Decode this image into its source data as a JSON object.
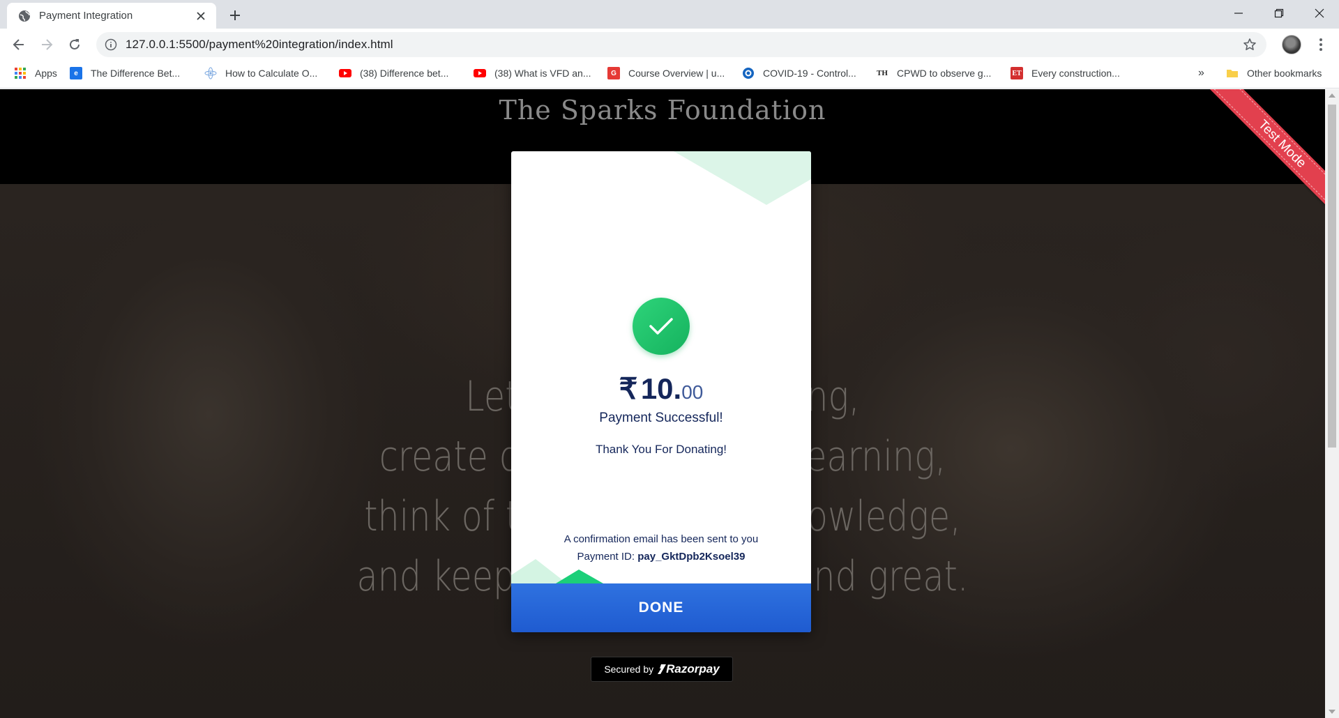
{
  "browser": {
    "tab": {
      "title": "Payment Integration",
      "favicon": "globe-icon"
    },
    "url": "127.0.0.1:5500/payment%20integration/index.html",
    "bookmarks": [
      {
        "label": "Apps",
        "icon": "apps-grid-icon",
        "color": "#ea4335"
      },
      {
        "label": "The Difference Bet...",
        "icon": "site-icon",
        "color": "#1a73e8"
      },
      {
        "label": "How to Calculate O...",
        "icon": "site-icon",
        "color": "#9aa0a6"
      },
      {
        "label": "(38) Difference bet...",
        "icon": "youtube-icon",
        "color": "#ff0000"
      },
      {
        "label": "(38) What is VFD an...",
        "icon": "youtube-icon",
        "color": "#ff0000"
      },
      {
        "label": "Course Overview | u...",
        "icon": "site-icon",
        "color": "#e53935"
      },
      {
        "label": "COVID-19 - Control...",
        "icon": "site-icon",
        "color": "#1565c0"
      },
      {
        "label": "CPWD to observe g...",
        "icon": "site-icon",
        "color": "#333333"
      },
      {
        "label": "Every construction...",
        "icon": "site-icon",
        "color": "#d32f2f"
      }
    ],
    "overflow_label": "»",
    "other_bookmarks": "Other bookmarks"
  },
  "page": {
    "site_title": "The Sparks Foundation",
    "quote_lines": [
      "Let us touch the dying,",
      "create opportunities for learning,",
      "think of the children of knowledge,",
      "and keep our heads high and great."
    ],
    "ribbon": "Test Mode"
  },
  "modal": {
    "currency": "₹",
    "amount_major": "10.",
    "amount_minor": "00",
    "status": "Payment Successful!",
    "thanks": "Thank You For Donating!",
    "email_note": "A confirmation email has been sent to you",
    "payment_id_label": "Payment ID:",
    "payment_id": "pay_GktDpb2Ksoel39",
    "done_label": "DONE",
    "accent_color": "#1f5bd0",
    "success_color": "#15b25e"
  },
  "footer": {
    "secured_label": "Secured by",
    "brand": "Razorpay"
  }
}
